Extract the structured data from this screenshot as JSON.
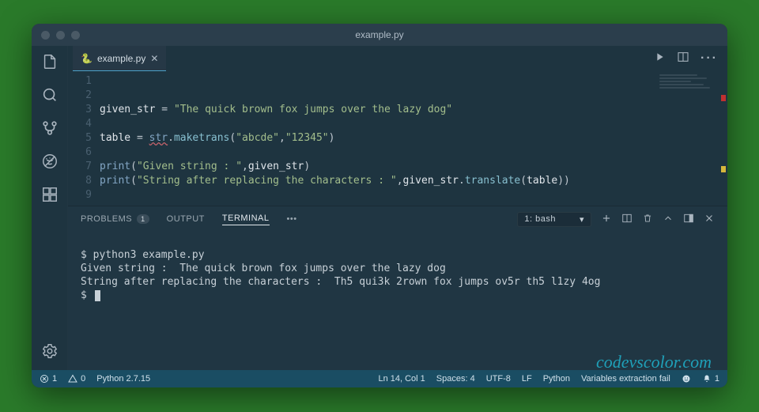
{
  "title": "example.py",
  "tab": {
    "label": "example.py"
  },
  "code": {
    "lines": [
      "1",
      "2",
      "3",
      "4",
      "5",
      "6",
      "7",
      "8",
      "9"
    ],
    "l2_var": "given_str",
    "l2_str": "\"The quick brown fox jumps over the lazy dog\"",
    "l4_table": "table",
    "l4_str": "str",
    "l4_meth": "maketrans",
    "l4_arg1": "\"abcde\"",
    "l4_arg2": "\"12345\"",
    "l6_print": "print",
    "l6_s": "\"Given string : \"",
    "l6_v": "given_str",
    "l7_print": "print",
    "l7_s": "\"String after replacing the characters : \"",
    "l7_v": "given_str",
    "l7_m": "translate",
    "l7_t": "table"
  },
  "panel": {
    "problems": "PROBLEMS",
    "problems_count": "1",
    "output": "OUTPUT",
    "terminal": "TERMINAL",
    "more": "•••",
    "select": "1: bash"
  },
  "terminal": {
    "l1": "$ python3 example.py",
    "l2": "Given string :  The quick brown fox jumps over the lazy dog",
    "l3": "String after replacing the characters :  Th5 qui3k 2rown fox jumps ov5r th5 l1zy 4og",
    "l4": "$ "
  },
  "status": {
    "errors": "1",
    "warnings": "0",
    "python": "Python 2.7.15",
    "pos": "Ln 14, Col 1",
    "spaces": "Spaces: 4",
    "enc": "UTF-8",
    "eol": "LF",
    "lang": "Python",
    "right_msg": "Variables extraction fail",
    "bell": "1"
  },
  "watermark": "codevscolor.com"
}
